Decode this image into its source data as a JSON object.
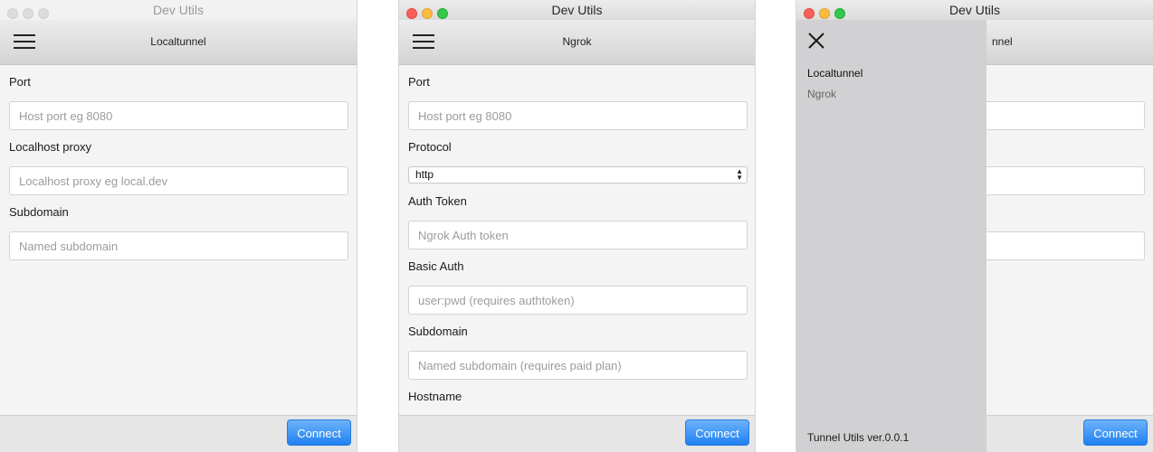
{
  "app_title": "Dev Utils",
  "colors": {
    "accent": "#2a85f5",
    "drawer_bg": "#d1d0d2",
    "window_bg": "#f4f4f4"
  },
  "icons": {
    "menu": "hamburger-menu-icon",
    "close": "close-icon",
    "select": "select-arrows-icon"
  },
  "window1": {
    "header_title": "Localtunnel",
    "fields": [
      {
        "label": "Port",
        "placeholder": "Host port eg 8080",
        "value": ""
      },
      {
        "label": "Localhost proxy",
        "placeholder": "Localhost proxy eg local.dev",
        "value": ""
      },
      {
        "label": "Subdomain",
        "placeholder": "Named subdomain",
        "value": ""
      }
    ],
    "connect_label": "Connect"
  },
  "window2": {
    "header_title": "Ngrok",
    "port": {
      "label": "Port",
      "placeholder": "Host port eg 8080"
    },
    "protocol": {
      "label": "Protocol",
      "selected": "http"
    },
    "auth_token": {
      "label": "Auth Token",
      "placeholder": "Ngrok Auth token"
    },
    "basic_auth": {
      "label": "Basic Auth",
      "placeholder": "user:pwd (requires authtoken)"
    },
    "subdomain": {
      "label": "Subdomain",
      "placeholder": "Named subdomain (requires paid plan)"
    },
    "hostname": {
      "label": "Hostname"
    },
    "connect_label": "Connect"
  },
  "window3": {
    "header_title_partial": "nnel",
    "drawer": {
      "items": [
        {
          "label": "Localtunnel",
          "active": true
        },
        {
          "label": "Ngrok",
          "active": false
        }
      ],
      "version": "Tunnel Utils ver.0.0.1"
    },
    "connect_label": "Connect"
  }
}
